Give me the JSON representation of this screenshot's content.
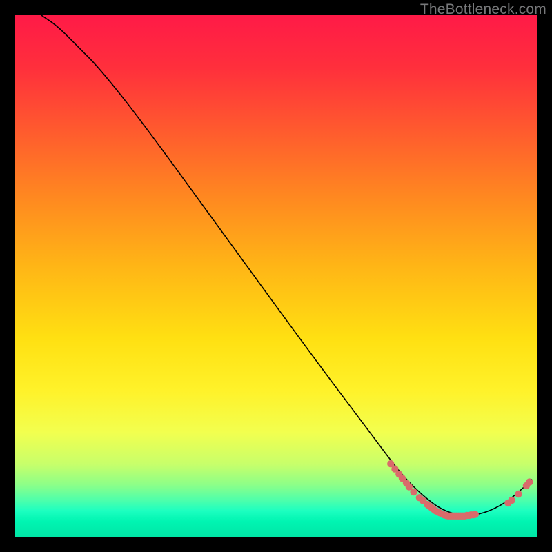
{
  "watermark": "TheBottleneck.com",
  "colors": {
    "curve": "#000000",
    "points": "#d96b6b",
    "background_top": "#ff1a47",
    "background_bottom": "#00e6a6"
  },
  "chart_data": {
    "type": "line",
    "title": "",
    "xlabel": "",
    "ylabel": "",
    "xlim": [
      0,
      100
    ],
    "ylim": [
      0,
      100
    ],
    "curve": [
      {
        "x": 5,
        "y": 100
      },
      {
        "x": 8,
        "y": 98
      },
      {
        "x": 12,
        "y": 94
      },
      {
        "x": 16,
        "y": 90
      },
      {
        "x": 24,
        "y": 80
      },
      {
        "x": 40,
        "y": 58
      },
      {
        "x": 56,
        "y": 36
      },
      {
        "x": 68,
        "y": 20
      },
      {
        "x": 74,
        "y": 12
      },
      {
        "x": 78,
        "y": 8
      },
      {
        "x": 82,
        "y": 5
      },
      {
        "x": 86,
        "y": 4
      },
      {
        "x": 90,
        "y": 4.5
      },
      {
        "x": 94,
        "y": 6.5
      },
      {
        "x": 97,
        "y": 9
      },
      {
        "x": 99,
        "y": 11
      }
    ],
    "points": [
      {
        "x": 72.0,
        "y": 14.0
      },
      {
        "x": 72.8,
        "y": 13.0
      },
      {
        "x": 73.6,
        "y": 12.0
      },
      {
        "x": 74.2,
        "y": 11.2
      },
      {
        "x": 75.0,
        "y": 10.3
      },
      {
        "x": 75.5,
        "y": 9.6
      },
      {
        "x": 76.4,
        "y": 8.6
      },
      {
        "x": 77.5,
        "y": 7.5
      },
      {
        "x": 78.2,
        "y": 6.9
      },
      {
        "x": 79.0,
        "y": 6.2
      },
      {
        "x": 79.4,
        "y": 5.9
      },
      {
        "x": 79.8,
        "y": 5.6
      },
      {
        "x": 80.2,
        "y": 5.3
      },
      {
        "x": 80.6,
        "y": 5.0
      },
      {
        "x": 81.0,
        "y": 4.8
      },
      {
        "x": 81.4,
        "y": 4.6
      },
      {
        "x": 81.8,
        "y": 4.4
      },
      {
        "x": 82.2,
        "y": 4.2
      },
      {
        "x": 82.6,
        "y": 4.1
      },
      {
        "x": 83.0,
        "y": 4.0
      },
      {
        "x": 83.4,
        "y": 4.0
      },
      {
        "x": 83.8,
        "y": 4.0
      },
      {
        "x": 84.2,
        "y": 4.0
      },
      {
        "x": 84.6,
        "y": 4.0
      },
      {
        "x": 85.0,
        "y": 4.0
      },
      {
        "x": 85.4,
        "y": 4.0
      },
      {
        "x": 85.8,
        "y": 4.0
      },
      {
        "x": 86.2,
        "y": 4.0
      },
      {
        "x": 86.6,
        "y": 4.1
      },
      {
        "x": 87.0,
        "y": 4.1
      },
      {
        "x": 87.4,
        "y": 4.2
      },
      {
        "x": 87.8,
        "y": 4.2
      },
      {
        "x": 88.2,
        "y": 4.3
      },
      {
        "x": 94.5,
        "y": 6.5
      },
      {
        "x": 95.2,
        "y": 7.0
      },
      {
        "x": 96.5,
        "y": 8.2
      },
      {
        "x": 98.0,
        "y": 9.8
      },
      {
        "x": 98.6,
        "y": 10.5
      }
    ]
  }
}
